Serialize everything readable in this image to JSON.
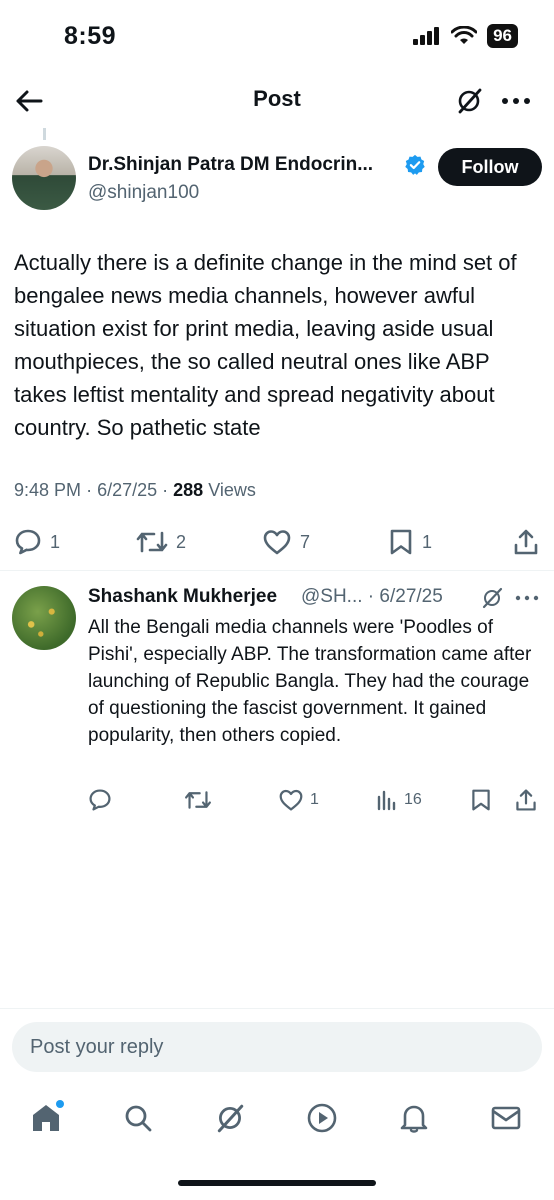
{
  "status_bar": {
    "time": "8:59",
    "battery": "96"
  },
  "nav": {
    "title": "Post"
  },
  "post": {
    "author_name": "Dr.Shinjan Patra DM Endocrin...",
    "author_handle": "@shinjan100",
    "follow_label": "Follow",
    "text": "Actually there is a definite change in the mind set of bengalee news media channels, however awful situation exist for print media, leaving aside usual mouthpieces, the so called neutral ones like ABP takes leftist mentality and spread negativity about country. So pathetic state",
    "time": "9:48 PM",
    "date": "6/27/25",
    "views_count": "288",
    "views_label": "Views",
    "replies": "1",
    "reposts": "2",
    "likes": "7",
    "bookmarks": "1"
  },
  "reply": {
    "author_name": "Shashank Mukherjee",
    "handle_date": "@SH... · 6/27/25",
    "text": "All the Bengali media channels were 'Poodles of Pishi', especially ABP. The transformation came after launching of Republic Bangla. They had the courage of questioning the fascist government. It gained popularity, then others copied.",
    "likes": "1",
    "views": "16"
  },
  "composer": {
    "placeholder": "Post your reply"
  },
  "colors": {
    "verified": "#1d9bf0",
    "text_primary": "#0f1419",
    "text_secondary": "#536471",
    "notification_dot": "#1d9bf0"
  },
  "icons": [
    "back-arrow-icon",
    "grok-icon",
    "more-icon",
    "verified-icon",
    "reply-icon",
    "repost-icon",
    "like-icon",
    "bookmark-icon",
    "share-icon",
    "views-icon",
    "home-icon",
    "search-icon",
    "play-icon",
    "bell-icon",
    "mail-icon"
  ]
}
